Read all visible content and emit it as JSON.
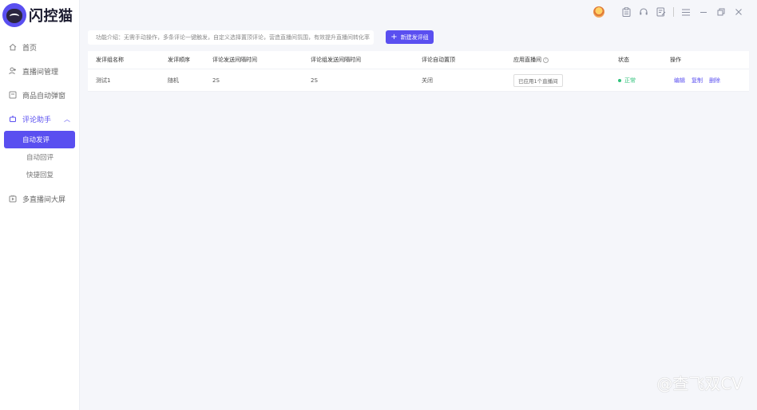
{
  "app": {
    "logo_text": "闪控猫"
  },
  "sidebar": {
    "items": [
      {
        "label": "首页",
        "icon": "home-icon"
      },
      {
        "label": "直播间管理",
        "icon": "user-manage-icon"
      },
      {
        "label": "商品自动弹窗",
        "icon": "popup-icon"
      },
      {
        "label": "评论助手",
        "icon": "robot-icon"
      },
      {
        "label": "多直播间大屏",
        "icon": "screen-icon"
      }
    ],
    "sub_items": [
      "自动发评",
      "自动回评",
      "快捷回复"
    ]
  },
  "main": {
    "intro": "功能介绍：无需手动操作，多条评论一键触发，自定义选择置顶评论，营造直播间氛围，有效提升直播间转化率",
    "new_button": "新建发评组",
    "table": {
      "headers": [
        "发评组名称",
        "发评顺序",
        "评论发送间隔时间",
        "评论组发送间隔时间",
        "评论自动置顶",
        "应用直播间",
        "状态",
        "操作"
      ],
      "rows": [
        {
          "name": "测试1",
          "order": "随机",
          "comment_interval": "2S",
          "group_interval": "2S",
          "auto_pin": "关闭",
          "applied": "已应用1个直播间",
          "status": "正常",
          "actions": [
            "编辑",
            "复制",
            "删除"
          ]
        }
      ]
    }
  },
  "watermark": "@查飞双CV",
  "colors": {
    "accent": "#5a4ff0",
    "status_ok": "#2fc27a"
  }
}
